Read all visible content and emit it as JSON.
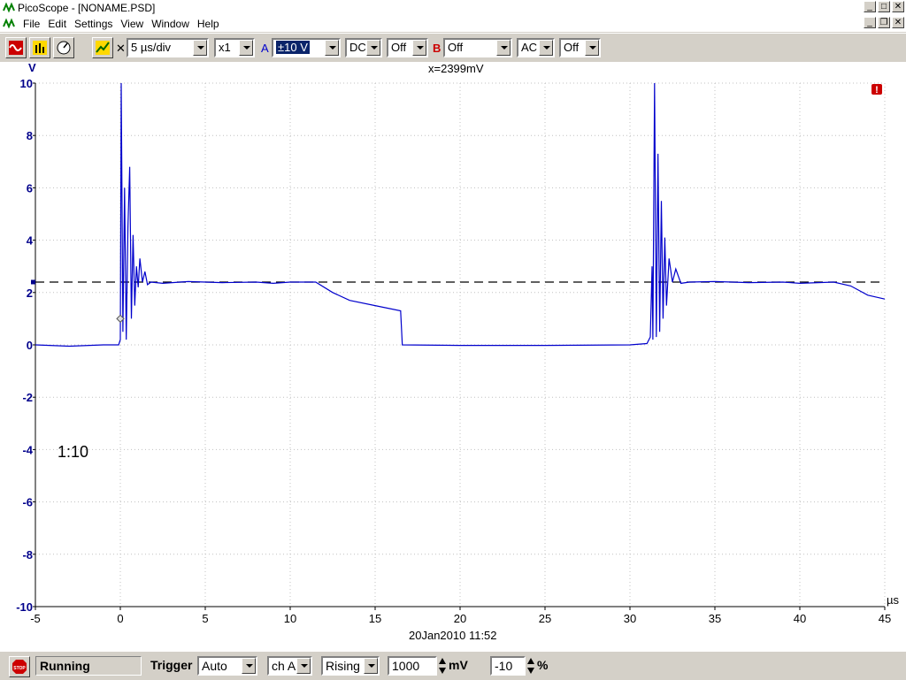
{
  "window": {
    "title": "PicoScope - [NONAME.PSD]",
    "menu": [
      "File",
      "Edit",
      "Settings",
      "View",
      "Window",
      "Help"
    ]
  },
  "toolbar": {
    "timebase": "5 µs/div",
    "multiplier": "x1",
    "channel_a_label": "A",
    "channel_a_range": "±10 V",
    "channel_a_coupling": "DC",
    "channel_a_extra": "Off",
    "channel_b_label": "B",
    "channel_b_range": "Off",
    "channel_b_coupling": "AC",
    "channel_b_extra": "Off",
    "x_symbol": "✕"
  },
  "plot": {
    "cursor_readout": "x=2399mV",
    "y_unit": "V",
    "x_unit": "µs",
    "probe_note": "1:10",
    "timestamp": "20Jan2010  11:52",
    "warning_icon": "exclamation-icon"
  },
  "chart_data": {
    "type": "line",
    "xlabel": "µs",
    "ylabel": "V",
    "xlim": [
      -5,
      45
    ],
    "ylim": [
      -10,
      10
    ],
    "x_ticks": [
      -5,
      0,
      5,
      10,
      15,
      20,
      25,
      30,
      35,
      40,
      45
    ],
    "y_ticks": [
      10,
      8,
      6,
      4,
      2,
      0,
      -2,
      -4,
      -6,
      -8,
      -10
    ],
    "grid": true,
    "cursor_y": 2.399,
    "trigger_marker": {
      "x": 0,
      "y": 1.0
    },
    "series": [
      {
        "color": "#0000cc",
        "points": [
          [
            -5,
            0.0
          ],
          [
            -3,
            -0.05
          ],
          [
            -1,
            0.0
          ],
          [
            -0.1,
            0.0
          ],
          [
            0,
            0.2
          ],
          [
            0.05,
            10.0
          ],
          [
            0.15,
            0.5
          ],
          [
            0.25,
            6.0
          ],
          [
            0.35,
            0.2
          ],
          [
            0.45,
            4.5
          ],
          [
            0.55,
            6.8
          ],
          [
            0.65,
            1.0
          ],
          [
            0.75,
            4.2
          ],
          [
            0.85,
            1.5
          ],
          [
            0.95,
            3.0
          ],
          [
            1.05,
            2.2
          ],
          [
            1.15,
            3.3
          ],
          [
            1.3,
            2.4
          ],
          [
            1.45,
            2.8
          ],
          [
            1.6,
            2.3
          ],
          [
            1.8,
            2.4
          ],
          [
            2.5,
            2.35
          ],
          [
            4,
            2.42
          ],
          [
            6,
            2.38
          ],
          [
            8,
            2.4
          ],
          [
            9,
            2.35
          ],
          [
            10,
            2.4
          ],
          [
            11.5,
            2.4
          ],
          [
            12.5,
            2.0
          ],
          [
            13.5,
            1.7
          ],
          [
            15,
            1.5
          ],
          [
            16.5,
            1.3
          ],
          [
            16.6,
            0.0
          ],
          [
            20,
            -0.02
          ],
          [
            25,
            -0.02
          ],
          [
            30,
            0.0
          ],
          [
            31,
            0.05
          ],
          [
            31.2,
            0.3
          ],
          [
            31.3,
            3.0
          ],
          [
            31.35,
            0.2
          ],
          [
            31.45,
            10.0
          ],
          [
            31.55,
            0.3
          ],
          [
            31.65,
            7.3
          ],
          [
            31.75,
            0.5
          ],
          [
            31.85,
            5.5
          ],
          [
            31.95,
            1.0
          ],
          [
            32.05,
            4.1
          ],
          [
            32.15,
            1.5
          ],
          [
            32.3,
            3.3
          ],
          [
            32.5,
            2.4
          ],
          [
            32.7,
            2.9
          ],
          [
            33,
            2.35
          ],
          [
            33.5,
            2.4
          ],
          [
            35,
            2.42
          ],
          [
            37,
            2.38
          ],
          [
            39,
            2.4
          ],
          [
            40,
            2.35
          ],
          [
            42,
            2.4
          ],
          [
            43,
            2.25
          ],
          [
            44,
            1.9
          ],
          [
            45,
            1.75
          ]
        ]
      }
    ]
  },
  "statusbar": {
    "state": "Running",
    "trigger_label": "Trigger",
    "trigger_mode": "Auto",
    "trigger_channel": "ch A",
    "trigger_edge": "Rising",
    "threshold": "1000",
    "threshold_unit": "mV",
    "delay": "-10",
    "delay_unit": "%"
  },
  "colors": {
    "trace": "#0000cc",
    "axis_labels": "#00008b",
    "grid": "#c0c0c0"
  }
}
